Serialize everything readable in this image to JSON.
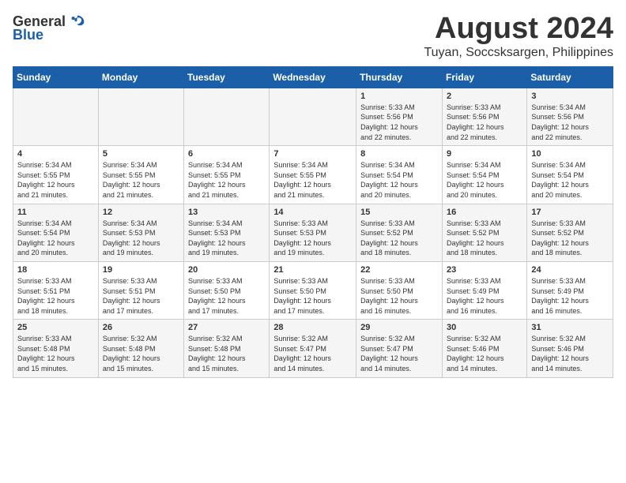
{
  "header": {
    "logo_general": "General",
    "logo_blue": "Blue",
    "month": "August 2024",
    "location": "Tuyan, Soccsksargen, Philippines"
  },
  "weekdays": [
    "Sunday",
    "Monday",
    "Tuesday",
    "Wednesday",
    "Thursday",
    "Friday",
    "Saturday"
  ],
  "weeks": [
    [
      {
        "day": "",
        "info": ""
      },
      {
        "day": "",
        "info": ""
      },
      {
        "day": "",
        "info": ""
      },
      {
        "day": "",
        "info": ""
      },
      {
        "day": "1",
        "info": "Sunrise: 5:33 AM\nSunset: 5:56 PM\nDaylight: 12 hours\nand 22 minutes."
      },
      {
        "day": "2",
        "info": "Sunrise: 5:33 AM\nSunset: 5:56 PM\nDaylight: 12 hours\nand 22 minutes."
      },
      {
        "day": "3",
        "info": "Sunrise: 5:34 AM\nSunset: 5:56 PM\nDaylight: 12 hours\nand 22 minutes."
      }
    ],
    [
      {
        "day": "4",
        "info": "Sunrise: 5:34 AM\nSunset: 5:55 PM\nDaylight: 12 hours\nand 21 minutes."
      },
      {
        "day": "5",
        "info": "Sunrise: 5:34 AM\nSunset: 5:55 PM\nDaylight: 12 hours\nand 21 minutes."
      },
      {
        "day": "6",
        "info": "Sunrise: 5:34 AM\nSunset: 5:55 PM\nDaylight: 12 hours\nand 21 minutes."
      },
      {
        "day": "7",
        "info": "Sunrise: 5:34 AM\nSunset: 5:55 PM\nDaylight: 12 hours\nand 21 minutes."
      },
      {
        "day": "8",
        "info": "Sunrise: 5:34 AM\nSunset: 5:54 PM\nDaylight: 12 hours\nand 20 minutes."
      },
      {
        "day": "9",
        "info": "Sunrise: 5:34 AM\nSunset: 5:54 PM\nDaylight: 12 hours\nand 20 minutes."
      },
      {
        "day": "10",
        "info": "Sunrise: 5:34 AM\nSunset: 5:54 PM\nDaylight: 12 hours\nand 20 minutes."
      }
    ],
    [
      {
        "day": "11",
        "info": "Sunrise: 5:34 AM\nSunset: 5:54 PM\nDaylight: 12 hours\nand 20 minutes."
      },
      {
        "day": "12",
        "info": "Sunrise: 5:34 AM\nSunset: 5:53 PM\nDaylight: 12 hours\nand 19 minutes."
      },
      {
        "day": "13",
        "info": "Sunrise: 5:34 AM\nSunset: 5:53 PM\nDaylight: 12 hours\nand 19 minutes."
      },
      {
        "day": "14",
        "info": "Sunrise: 5:33 AM\nSunset: 5:53 PM\nDaylight: 12 hours\nand 19 minutes."
      },
      {
        "day": "15",
        "info": "Sunrise: 5:33 AM\nSunset: 5:52 PM\nDaylight: 12 hours\nand 18 minutes."
      },
      {
        "day": "16",
        "info": "Sunrise: 5:33 AM\nSunset: 5:52 PM\nDaylight: 12 hours\nand 18 minutes."
      },
      {
        "day": "17",
        "info": "Sunrise: 5:33 AM\nSunset: 5:52 PM\nDaylight: 12 hours\nand 18 minutes."
      }
    ],
    [
      {
        "day": "18",
        "info": "Sunrise: 5:33 AM\nSunset: 5:51 PM\nDaylight: 12 hours\nand 18 minutes."
      },
      {
        "day": "19",
        "info": "Sunrise: 5:33 AM\nSunset: 5:51 PM\nDaylight: 12 hours\nand 17 minutes."
      },
      {
        "day": "20",
        "info": "Sunrise: 5:33 AM\nSunset: 5:50 PM\nDaylight: 12 hours\nand 17 minutes."
      },
      {
        "day": "21",
        "info": "Sunrise: 5:33 AM\nSunset: 5:50 PM\nDaylight: 12 hours\nand 17 minutes."
      },
      {
        "day": "22",
        "info": "Sunrise: 5:33 AM\nSunset: 5:50 PM\nDaylight: 12 hours\nand 16 minutes."
      },
      {
        "day": "23",
        "info": "Sunrise: 5:33 AM\nSunset: 5:49 PM\nDaylight: 12 hours\nand 16 minutes."
      },
      {
        "day": "24",
        "info": "Sunrise: 5:33 AM\nSunset: 5:49 PM\nDaylight: 12 hours\nand 16 minutes."
      }
    ],
    [
      {
        "day": "25",
        "info": "Sunrise: 5:33 AM\nSunset: 5:48 PM\nDaylight: 12 hours\nand 15 minutes."
      },
      {
        "day": "26",
        "info": "Sunrise: 5:32 AM\nSunset: 5:48 PM\nDaylight: 12 hours\nand 15 minutes."
      },
      {
        "day": "27",
        "info": "Sunrise: 5:32 AM\nSunset: 5:48 PM\nDaylight: 12 hours\nand 15 minutes."
      },
      {
        "day": "28",
        "info": "Sunrise: 5:32 AM\nSunset: 5:47 PM\nDaylight: 12 hours\nand 14 minutes."
      },
      {
        "day": "29",
        "info": "Sunrise: 5:32 AM\nSunset: 5:47 PM\nDaylight: 12 hours\nand 14 minutes."
      },
      {
        "day": "30",
        "info": "Sunrise: 5:32 AM\nSunset: 5:46 PM\nDaylight: 12 hours\nand 14 minutes."
      },
      {
        "day": "31",
        "info": "Sunrise: 5:32 AM\nSunset: 5:46 PM\nDaylight: 12 hours\nand 14 minutes."
      }
    ]
  ]
}
